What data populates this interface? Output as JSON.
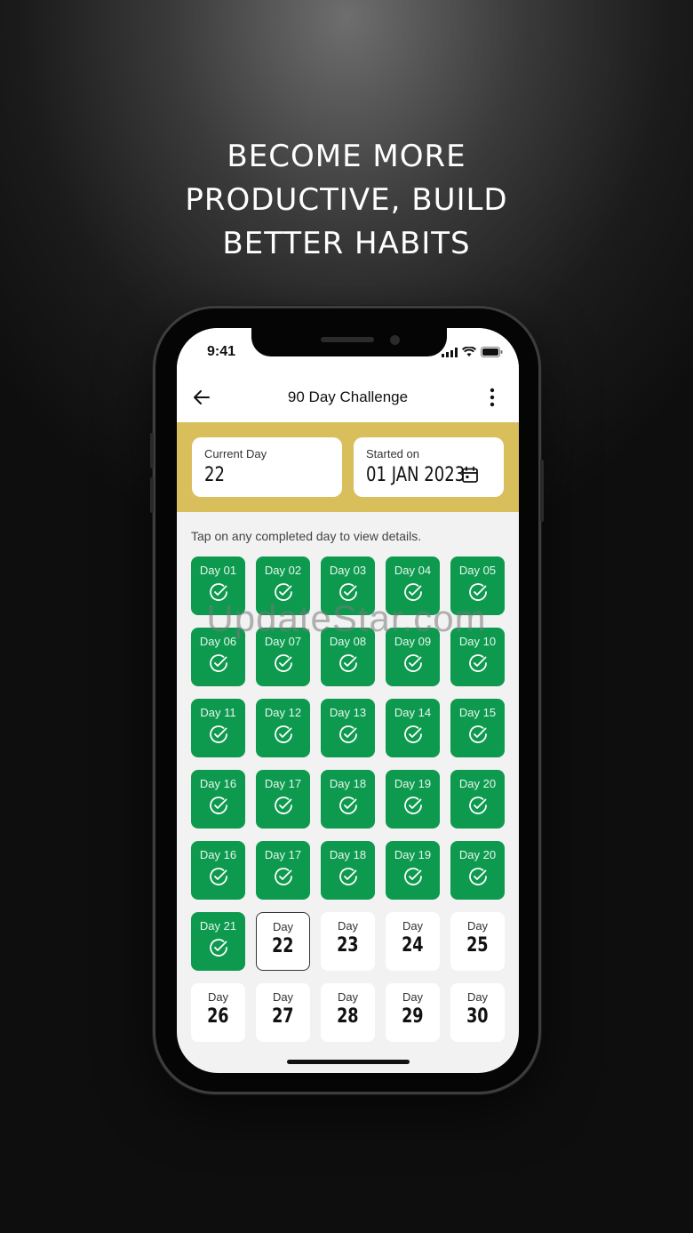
{
  "headline": [
    "BECOME MORE",
    "PRODUCTIVE, BUILD",
    "BETTER HABITS"
  ],
  "status_bar": {
    "time": "9:41"
  },
  "app_bar": {
    "title": "90 Day Challenge"
  },
  "info": {
    "current_day_label": "Current Day",
    "current_day_value": "22",
    "started_on_label": "Started on",
    "started_on_value": "01 JAN 2023"
  },
  "hint": "Tap on any completed day to view details.",
  "colors": {
    "accent_green": "#0d9a4f",
    "band_gold": "#d9bf5c"
  },
  "days": [
    {
      "label": "Day 01",
      "state": "done"
    },
    {
      "label": "Day 02",
      "state": "done"
    },
    {
      "label": "Day 03",
      "state": "done"
    },
    {
      "label": "Day 04",
      "state": "done"
    },
    {
      "label": "Day 05",
      "state": "done"
    },
    {
      "label": "Day 06",
      "state": "done"
    },
    {
      "label": "Day 07",
      "state": "done"
    },
    {
      "label": "Day 08",
      "state": "done"
    },
    {
      "label": "Day 09",
      "state": "done"
    },
    {
      "label": "Day 10",
      "state": "done"
    },
    {
      "label": "Day 11",
      "state": "done"
    },
    {
      "label": "Day 12",
      "state": "done"
    },
    {
      "label": "Day 13",
      "state": "done"
    },
    {
      "label": "Day 14",
      "state": "done"
    },
    {
      "label": "Day 15",
      "state": "done"
    },
    {
      "label": "Day 16",
      "state": "done"
    },
    {
      "label": "Day 17",
      "state": "done"
    },
    {
      "label": "Day 18",
      "state": "done"
    },
    {
      "label": "Day 19",
      "state": "done"
    },
    {
      "label": "Day 20",
      "state": "done"
    },
    {
      "label": "Day 16",
      "state": "done"
    },
    {
      "label": "Day 17",
      "state": "done"
    },
    {
      "label": "Day 18",
      "state": "done"
    },
    {
      "label": "Day 19",
      "state": "done"
    },
    {
      "label": "Day 20",
      "state": "done"
    },
    {
      "label": "Day 21",
      "state": "done"
    },
    {
      "label": "Day",
      "number": "22",
      "state": "current"
    },
    {
      "label": "Day",
      "number": "23",
      "state": "todo"
    },
    {
      "label": "Day",
      "number": "24",
      "state": "todo"
    },
    {
      "label": "Day",
      "number": "25",
      "state": "todo"
    },
    {
      "label": "Day",
      "number": "26",
      "state": "todo"
    },
    {
      "label": "Day",
      "number": "27",
      "state": "todo"
    },
    {
      "label": "Day",
      "number": "28",
      "state": "todo"
    },
    {
      "label": "Day",
      "number": "29",
      "state": "todo"
    },
    {
      "label": "Day",
      "number": "30",
      "state": "todo"
    }
  ],
  "watermark": "UpdateStar.com"
}
